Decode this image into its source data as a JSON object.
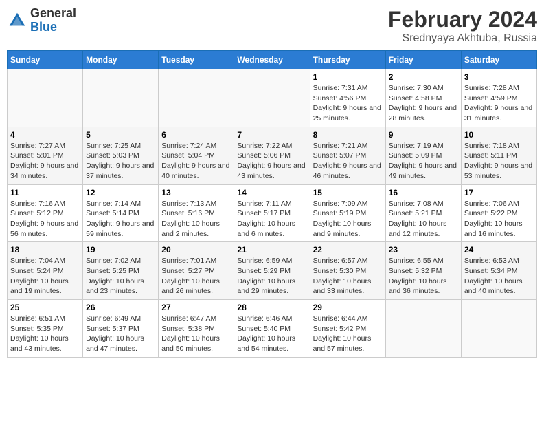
{
  "header": {
    "logo_general": "General",
    "logo_blue": "Blue",
    "month_year": "February 2024",
    "location": "Srednyaya Akhtuba, Russia"
  },
  "weekdays": [
    "Sunday",
    "Monday",
    "Tuesday",
    "Wednesday",
    "Thursday",
    "Friday",
    "Saturday"
  ],
  "weeks": [
    [
      {
        "day": "",
        "sunrise": "",
        "sunset": "",
        "daylight": "",
        "empty": true
      },
      {
        "day": "",
        "sunrise": "",
        "sunset": "",
        "daylight": "",
        "empty": true
      },
      {
        "day": "",
        "sunrise": "",
        "sunset": "",
        "daylight": "",
        "empty": true
      },
      {
        "day": "",
        "sunrise": "",
        "sunset": "",
        "daylight": "",
        "empty": true
      },
      {
        "day": "1",
        "sunrise": "Sunrise: 7:31 AM",
        "sunset": "Sunset: 4:56 PM",
        "daylight": "Daylight: 9 hours and 25 minutes.",
        "empty": false
      },
      {
        "day": "2",
        "sunrise": "Sunrise: 7:30 AM",
        "sunset": "Sunset: 4:58 PM",
        "daylight": "Daylight: 9 hours and 28 minutes.",
        "empty": false
      },
      {
        "day": "3",
        "sunrise": "Sunrise: 7:28 AM",
        "sunset": "Sunset: 4:59 PM",
        "daylight": "Daylight: 9 hours and 31 minutes.",
        "empty": false
      }
    ],
    [
      {
        "day": "4",
        "sunrise": "Sunrise: 7:27 AM",
        "sunset": "Sunset: 5:01 PM",
        "daylight": "Daylight: 9 hours and 34 minutes.",
        "empty": false
      },
      {
        "day": "5",
        "sunrise": "Sunrise: 7:25 AM",
        "sunset": "Sunset: 5:03 PM",
        "daylight": "Daylight: 9 hours and 37 minutes.",
        "empty": false
      },
      {
        "day": "6",
        "sunrise": "Sunrise: 7:24 AM",
        "sunset": "Sunset: 5:04 PM",
        "daylight": "Daylight: 9 hours and 40 minutes.",
        "empty": false
      },
      {
        "day": "7",
        "sunrise": "Sunrise: 7:22 AM",
        "sunset": "Sunset: 5:06 PM",
        "daylight": "Daylight: 9 hours and 43 minutes.",
        "empty": false
      },
      {
        "day": "8",
        "sunrise": "Sunrise: 7:21 AM",
        "sunset": "Sunset: 5:07 PM",
        "daylight": "Daylight: 9 hours and 46 minutes.",
        "empty": false
      },
      {
        "day": "9",
        "sunrise": "Sunrise: 7:19 AM",
        "sunset": "Sunset: 5:09 PM",
        "daylight": "Daylight: 9 hours and 49 minutes.",
        "empty": false
      },
      {
        "day": "10",
        "sunrise": "Sunrise: 7:18 AM",
        "sunset": "Sunset: 5:11 PM",
        "daylight": "Daylight: 9 hours and 53 minutes.",
        "empty": false
      }
    ],
    [
      {
        "day": "11",
        "sunrise": "Sunrise: 7:16 AM",
        "sunset": "Sunset: 5:12 PM",
        "daylight": "Daylight: 9 hours and 56 minutes.",
        "empty": false
      },
      {
        "day": "12",
        "sunrise": "Sunrise: 7:14 AM",
        "sunset": "Sunset: 5:14 PM",
        "daylight": "Daylight: 9 hours and 59 minutes.",
        "empty": false
      },
      {
        "day": "13",
        "sunrise": "Sunrise: 7:13 AM",
        "sunset": "Sunset: 5:16 PM",
        "daylight": "Daylight: 10 hours and 2 minutes.",
        "empty": false
      },
      {
        "day": "14",
        "sunrise": "Sunrise: 7:11 AM",
        "sunset": "Sunset: 5:17 PM",
        "daylight": "Daylight: 10 hours and 6 minutes.",
        "empty": false
      },
      {
        "day": "15",
        "sunrise": "Sunrise: 7:09 AM",
        "sunset": "Sunset: 5:19 PM",
        "daylight": "Daylight: 10 hours and 9 minutes.",
        "empty": false
      },
      {
        "day": "16",
        "sunrise": "Sunrise: 7:08 AM",
        "sunset": "Sunset: 5:21 PM",
        "daylight": "Daylight: 10 hours and 12 minutes.",
        "empty": false
      },
      {
        "day": "17",
        "sunrise": "Sunrise: 7:06 AM",
        "sunset": "Sunset: 5:22 PM",
        "daylight": "Daylight: 10 hours and 16 minutes.",
        "empty": false
      }
    ],
    [
      {
        "day": "18",
        "sunrise": "Sunrise: 7:04 AM",
        "sunset": "Sunset: 5:24 PM",
        "daylight": "Daylight: 10 hours and 19 minutes.",
        "empty": false
      },
      {
        "day": "19",
        "sunrise": "Sunrise: 7:02 AM",
        "sunset": "Sunset: 5:25 PM",
        "daylight": "Daylight: 10 hours and 23 minutes.",
        "empty": false
      },
      {
        "day": "20",
        "sunrise": "Sunrise: 7:01 AM",
        "sunset": "Sunset: 5:27 PM",
        "daylight": "Daylight: 10 hours and 26 minutes.",
        "empty": false
      },
      {
        "day": "21",
        "sunrise": "Sunrise: 6:59 AM",
        "sunset": "Sunset: 5:29 PM",
        "daylight": "Daylight: 10 hours and 29 minutes.",
        "empty": false
      },
      {
        "day": "22",
        "sunrise": "Sunrise: 6:57 AM",
        "sunset": "Sunset: 5:30 PM",
        "daylight": "Daylight: 10 hours and 33 minutes.",
        "empty": false
      },
      {
        "day": "23",
        "sunrise": "Sunrise: 6:55 AM",
        "sunset": "Sunset: 5:32 PM",
        "daylight": "Daylight: 10 hours and 36 minutes.",
        "empty": false
      },
      {
        "day": "24",
        "sunrise": "Sunrise: 6:53 AM",
        "sunset": "Sunset: 5:34 PM",
        "daylight": "Daylight: 10 hours and 40 minutes.",
        "empty": false
      }
    ],
    [
      {
        "day": "25",
        "sunrise": "Sunrise: 6:51 AM",
        "sunset": "Sunset: 5:35 PM",
        "daylight": "Daylight: 10 hours and 43 minutes.",
        "empty": false
      },
      {
        "day": "26",
        "sunrise": "Sunrise: 6:49 AM",
        "sunset": "Sunset: 5:37 PM",
        "daylight": "Daylight: 10 hours and 47 minutes.",
        "empty": false
      },
      {
        "day": "27",
        "sunrise": "Sunrise: 6:47 AM",
        "sunset": "Sunset: 5:38 PM",
        "daylight": "Daylight: 10 hours and 50 minutes.",
        "empty": false
      },
      {
        "day": "28",
        "sunrise": "Sunrise: 6:46 AM",
        "sunset": "Sunset: 5:40 PM",
        "daylight": "Daylight: 10 hours and 54 minutes.",
        "empty": false
      },
      {
        "day": "29",
        "sunrise": "Sunrise: 6:44 AM",
        "sunset": "Sunset: 5:42 PM",
        "daylight": "Daylight: 10 hours and 57 minutes.",
        "empty": false
      },
      {
        "day": "",
        "sunrise": "",
        "sunset": "",
        "daylight": "",
        "empty": true
      },
      {
        "day": "",
        "sunrise": "",
        "sunset": "",
        "daylight": "",
        "empty": true
      }
    ]
  ]
}
